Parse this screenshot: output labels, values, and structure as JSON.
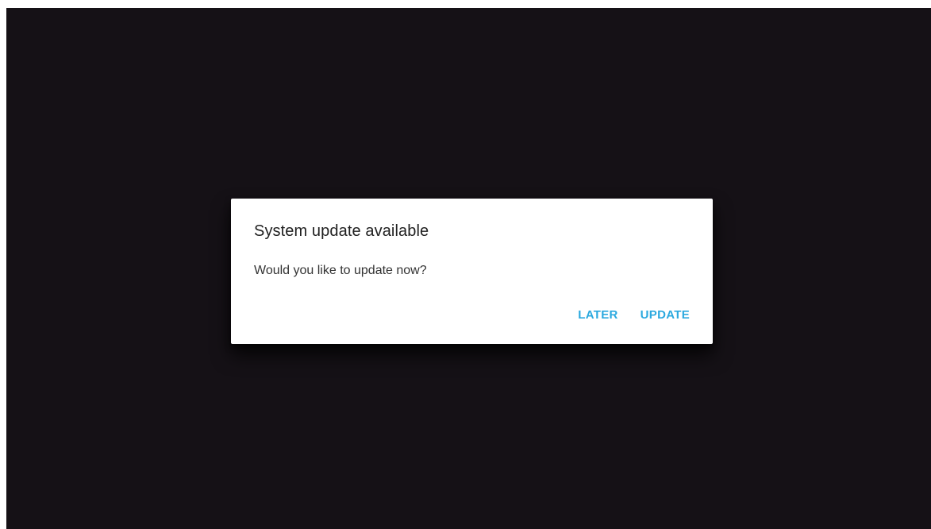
{
  "dialog": {
    "title": "System update available",
    "message": "Would you like to update now?",
    "actions": {
      "later_label": "LATER",
      "update_label": "UPDATE"
    }
  },
  "colors": {
    "background": "#151116",
    "dialog_background": "#ffffff",
    "accent": "#2ca9df"
  }
}
